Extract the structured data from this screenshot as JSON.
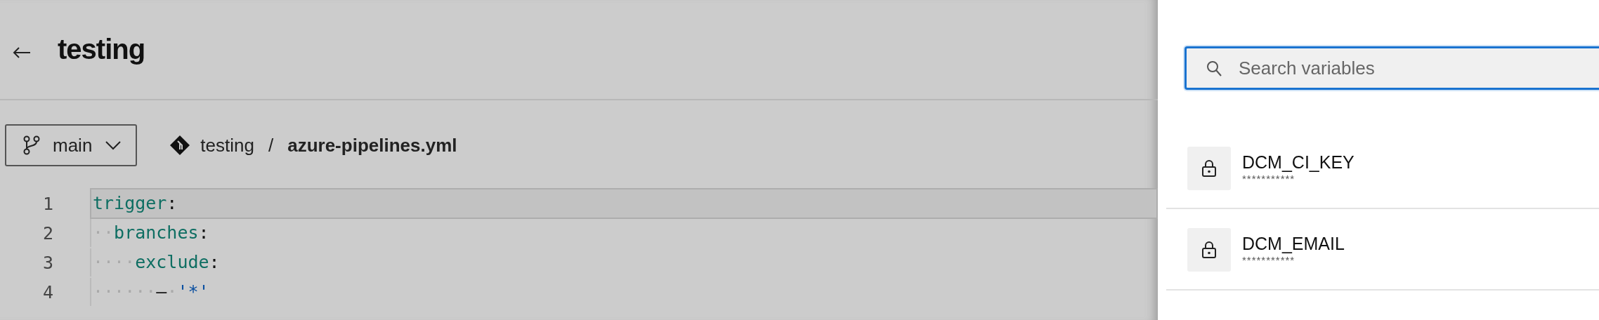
{
  "header": {
    "title": "testing"
  },
  "branch": {
    "label": "main"
  },
  "breadcrumb": {
    "repo": "testing",
    "separator": "/",
    "file": "azure-pipelines.yml"
  },
  "code": {
    "lines": [
      {
        "number": "1",
        "current": true,
        "tokens": [
          {
            "kind": "key",
            "text": "trigger"
          },
          {
            "kind": "punct",
            "text": ":"
          }
        ]
      },
      {
        "number": "2",
        "current": false,
        "tokens": [
          {
            "kind": "space",
            "text": "··"
          },
          {
            "kind": "key",
            "text": "branches"
          },
          {
            "kind": "punct",
            "text": ":"
          }
        ]
      },
      {
        "number": "3",
        "current": false,
        "tokens": [
          {
            "kind": "space",
            "text": "····"
          },
          {
            "kind": "key",
            "text": "exclude"
          },
          {
            "kind": "punct",
            "text": ":"
          }
        ]
      },
      {
        "number": "4",
        "current": false,
        "tokens": [
          {
            "kind": "space",
            "text": "······"
          },
          {
            "kind": "punct",
            "text": "–"
          },
          {
            "kind": "space",
            "text": "·"
          },
          {
            "kind": "string",
            "text": "'*'"
          }
        ]
      }
    ]
  },
  "panel": {
    "search": {
      "placeholder": "Search variables"
    },
    "variables": [
      {
        "name": "DCM_CI_KEY",
        "value": "***********"
      },
      {
        "name": "DCM_EMAIL",
        "value": "***********"
      }
    ]
  }
}
